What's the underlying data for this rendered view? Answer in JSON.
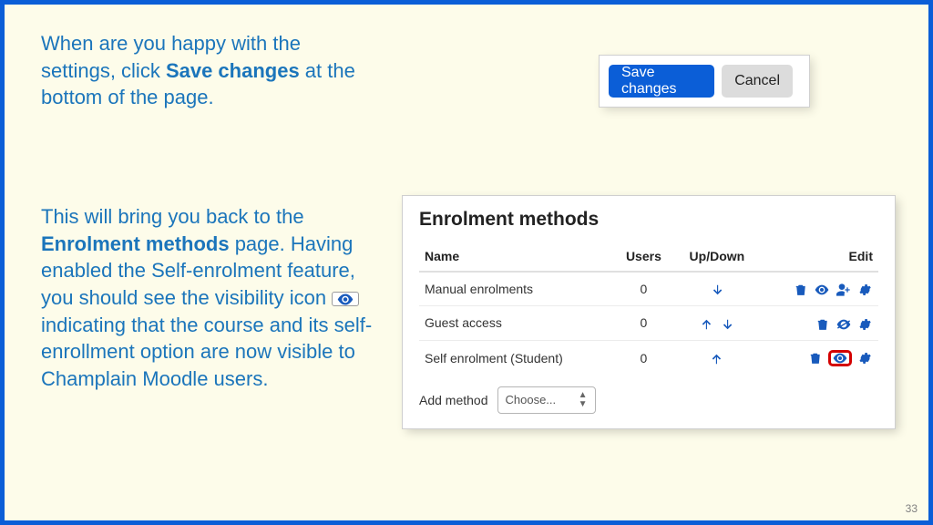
{
  "instr1": {
    "pre": "When are you happy with the settings, click ",
    "bold": "Save changes",
    "post": " at the bottom of the page."
  },
  "instr2": {
    "a": "This will bring you back to the ",
    "b": "Enrolment methods",
    "c": " page. Having enabled the Self-enrolment feature, you should see the visibility icon ",
    "d": " indicating that the course and its self-enrollment option are now visible to Champlain Moodle users."
  },
  "btns": {
    "save": "Save changes",
    "cancel": "Cancel"
  },
  "panel": {
    "title": "Enrolment methods",
    "headers": {
      "name": "Name",
      "users": "Users",
      "updown": "Up/Down",
      "edit": "Edit"
    },
    "rows": {
      "r0": {
        "name": "Manual enrolments",
        "users": "0"
      },
      "r1": {
        "name": "Guest access",
        "users": "0"
      },
      "r2": {
        "name": "Self enrolment (Student)",
        "users": "0"
      }
    },
    "addLabel": "Add method",
    "choose": "Choose..."
  },
  "pagenum": "33"
}
